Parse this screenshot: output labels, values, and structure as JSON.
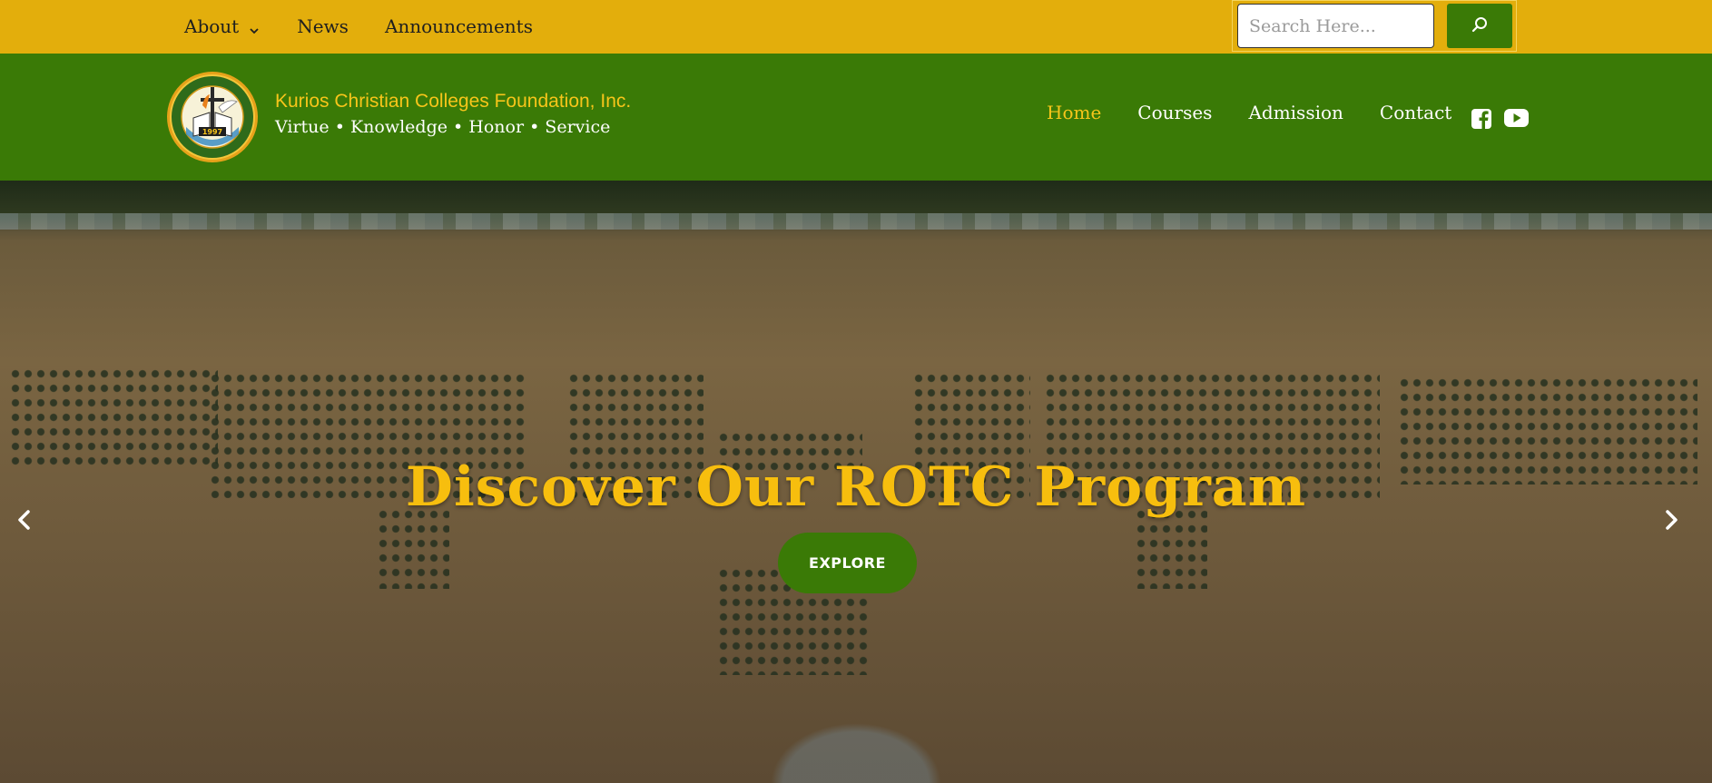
{
  "topbar": {
    "nav": [
      {
        "label": "About",
        "has_dropdown": true,
        "icon": "chevron-down-icon"
      },
      {
        "label": "News"
      },
      {
        "label": "Announcements"
      }
    ],
    "search": {
      "placeholder": "Search Here...",
      "value": "",
      "button_icon": "search-icon"
    },
    "colors": {
      "background": "#E3AE0C",
      "button": "#3A7A06"
    }
  },
  "header": {
    "logo": {
      "icon": "college-seal-logo",
      "seal_year": "1997"
    },
    "brand_name": "Kurios Christian Colleges Foundation, Inc.",
    "tagline": "Virtue • Knowledge • Honor • Service",
    "nav": [
      {
        "label": "Home",
        "active": true
      },
      {
        "label": "Courses"
      },
      {
        "label": "Admission"
      },
      {
        "label": "Contact"
      }
    ],
    "social": [
      {
        "icon": "facebook-icon"
      },
      {
        "icon": "youtube-icon"
      }
    ],
    "colors": {
      "background": "#3A7A06",
      "accent": "#F7C51A"
    }
  },
  "hero": {
    "title": "Discover Our ROTC Program",
    "button_label": "EXPLORE",
    "prev_icon": "chevron-left-icon",
    "next_icon": "chevron-right-icon",
    "colors": {
      "title": "#F7BE0E",
      "button": "#3A7A06"
    }
  }
}
